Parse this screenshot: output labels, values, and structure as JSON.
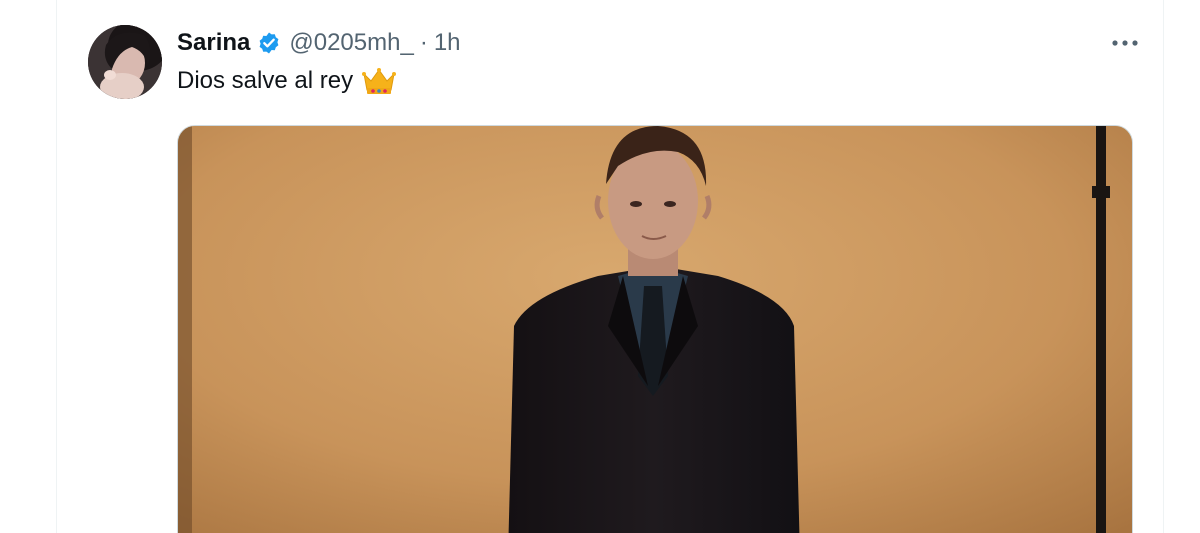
{
  "tweet": {
    "author": {
      "display_name": "Sarina",
      "handle": "@0205mh_",
      "verified": true,
      "avatar_icon": "profile-photo"
    },
    "separator": "·",
    "timestamp": "1h",
    "text": "Dios salve al rey",
    "emoji": "crown-emoji",
    "more_icon": "more-horizontal-icon",
    "media": {
      "type": "video-still",
      "subject": "man in dark suit against tan studio backdrop"
    }
  },
  "colors": {
    "name_text": "#0f1419",
    "secondary_text": "#536471",
    "verified_blue": "#1d9bf0",
    "backdrop": "#c9955b",
    "card_border": "#eff3f4"
  }
}
